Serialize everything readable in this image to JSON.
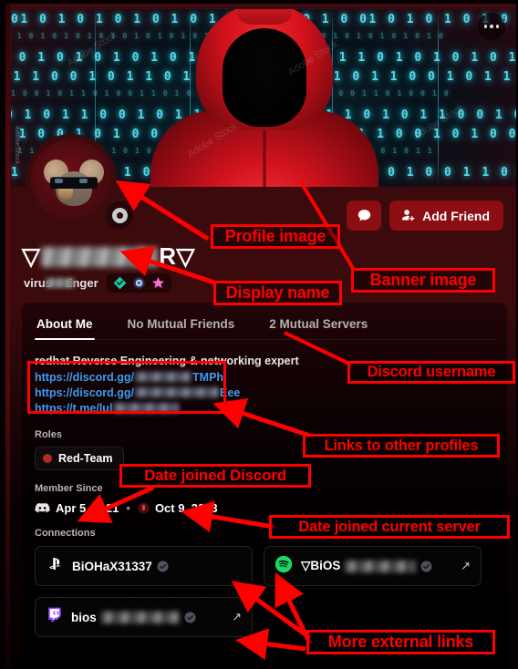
{
  "banner": {
    "code_rows": [
      "01 0 1 0 1 0 1 0 1 0 1 0 1 0 1 0 1 0",
      "0 1 0 1 0 1 0 1 0 1 0 1 0 1 0 1 0 1 0",
      "1 0 1 0 1 0 1 0 1 0 1 0 1 0 1 0 1 0 1",
      "0 1 1 0 0 1 0 1 1 0 1 0 0 1 0 1 1 0 1",
      "1 0 0 1 0 1 1 0 1 0 0 1 1 0 1 0 0 1 0",
      "0 1 0 1 1 0 0 1 0 1 1 0 1 0 0 1 0 1 1",
      "1 1 0 0 1 0 1 0 0 1 0 1 0 1 1 0 1 0 0",
      "0 0 1 1 0 1 0 1 1 0 1 0 1 0 0 1 0 1 1",
      "1 0 1 0 0 1 1 0 0 1 0 1 1 0 1 0 1 0 0"
    ],
    "watermark": "Adobe Stock",
    "side_watermark": "AdobeStock"
  },
  "header": {
    "more_options_label": "More options",
    "message_button_label": "Message",
    "add_friend_label": "Add Friend"
  },
  "profile": {
    "display_name_prefix": "▽",
    "display_name_suffix": "R▽",
    "username": "virus",
    "username_suffix": "tinger",
    "badges": [
      "verified-diamond-badge",
      "orb-badge",
      "pink-star-badge"
    ],
    "status": "idle"
  },
  "tabs": [
    {
      "label": "About Me",
      "active": true
    },
    {
      "label": "No Mutual Friends",
      "active": false
    },
    {
      "label": "2 Mutual Servers",
      "active": false
    }
  ],
  "about": {
    "bio": "redhat Reverse Engineering & networking expert",
    "links": [
      {
        "prefix": "https://discord.gg/",
        "suffix": "TMPh",
        "blur_width": 62
      },
      {
        "prefix": "https://discord.gg/",
        "suffix": "Eee",
        "blur_width": 92
      },
      {
        "prefix": "https://t.me/lul",
        "suffix": "",
        "blur_width": 72
      }
    ]
  },
  "roles": {
    "title": "Roles",
    "items": [
      {
        "name": "Red-Team",
        "color": "#b02a27"
      }
    ]
  },
  "member_since": {
    "title": "Member Since",
    "discord_date": "Apr 5, 2021",
    "separator": "•",
    "server_date": "Oct 9, 2023"
  },
  "connections": {
    "title": "Connections",
    "items": [
      {
        "service": "playstation-icon",
        "name": "BiOHaX31337",
        "verified": true,
        "blur_width": 0,
        "external": false
      },
      {
        "service": "spotify-icon",
        "name": "▽BiOS",
        "verified": true,
        "blur_width": 78,
        "external": true
      },
      {
        "service": "twitch-icon",
        "name": "bios",
        "verified": true,
        "blur_width": 86,
        "external": true
      }
    ]
  },
  "annotations": [
    {
      "id": "profile-image",
      "label": "Profile image"
    },
    {
      "id": "banner-image",
      "label": "Banner image"
    },
    {
      "id": "display-name",
      "label": "Display name"
    },
    {
      "id": "discord-username",
      "label": "Discord username"
    },
    {
      "id": "links-to-other-profiles",
      "label": "Links to other profiles"
    },
    {
      "id": "date-joined-discord",
      "label": "Date joined Discord"
    },
    {
      "id": "date-joined-current-server",
      "label": "Date joined current server"
    },
    {
      "id": "more-external-links",
      "label": "More external links"
    }
  ],
  "colors": {
    "annotation": "#fe0000",
    "accent": "#8c0d12",
    "link": "#3f9bf0"
  }
}
